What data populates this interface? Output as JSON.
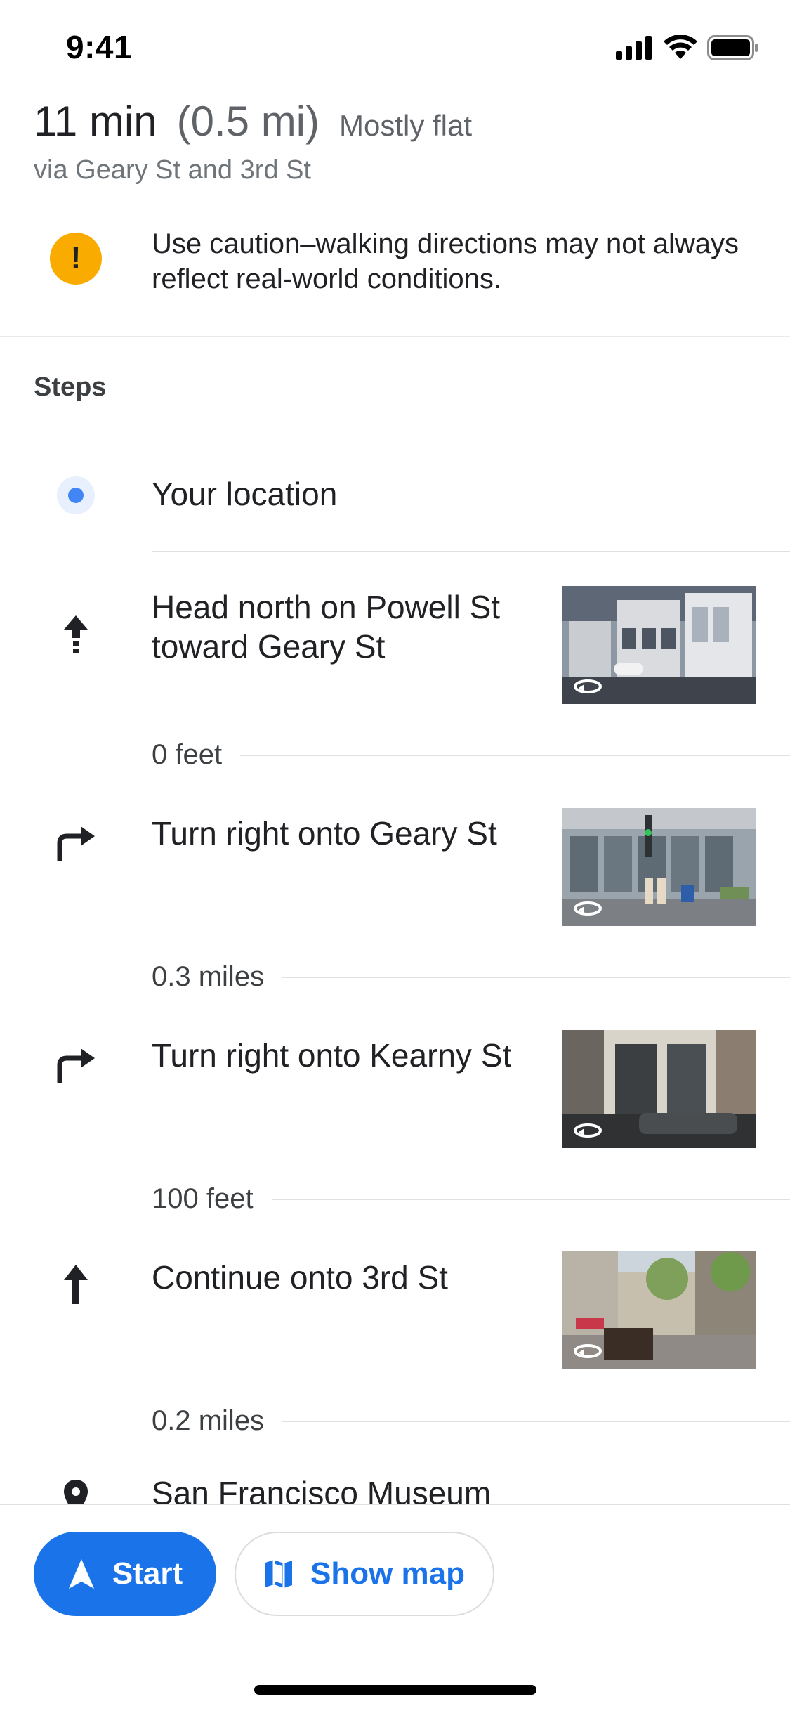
{
  "status_bar": {
    "time": "9:41"
  },
  "summary": {
    "duration": "11 min",
    "distance": "(0.5 mi)",
    "terrain": "Mostly flat",
    "via": "via Geary St and 3rd St"
  },
  "warning": {
    "text": "Use caution–walking directions may not always reflect real-world conditions."
  },
  "steps_header": "Steps",
  "origin": {
    "label": "Your location"
  },
  "steps": [
    {
      "instruction": "Head north on Powell St toward Geary St",
      "icon": "arrow-up-icon",
      "distance": "0 feet"
    },
    {
      "instruction": "Turn right onto Geary St",
      "icon": "turn-right-icon",
      "distance": "0.3 miles"
    },
    {
      "instruction": "Turn right onto Kearny St",
      "icon": "turn-right-icon",
      "distance": "100 feet"
    },
    {
      "instruction": "Continue onto 3rd St",
      "icon": "arrow-up-icon",
      "distance": "0.2 miles"
    }
  ],
  "destination": {
    "label": "San Francisco Museum"
  },
  "actions": {
    "start_label": "Start",
    "show_map_label": "Show map"
  },
  "colors": {
    "primary_blue": "#1a73e8",
    "warning_yellow": "#f9ab00",
    "location_blue": "#4285f4"
  }
}
